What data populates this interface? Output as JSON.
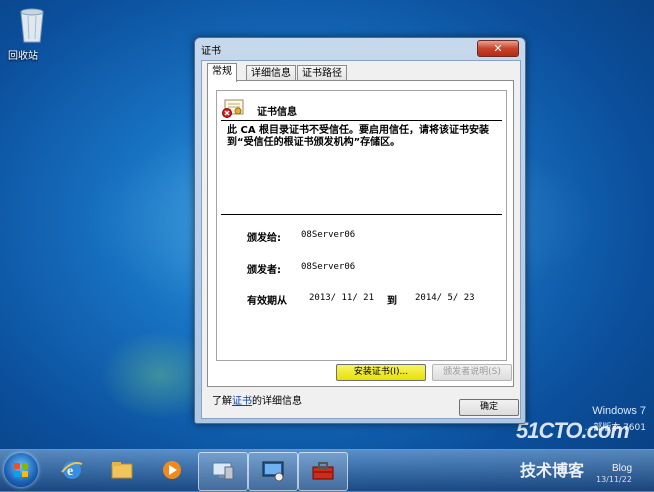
{
  "desktop": {
    "recycle_bin_label": "回收站",
    "os_name": "Windows 7",
    "build_text": "...部版本 7601",
    "watermark_site": "51CTO.com",
    "watermark_sub": "技术博客",
    "watermark_blog": "Blog",
    "watermark_date": "13/11/22"
  },
  "dialog": {
    "title": "证书",
    "close_label": "✕",
    "tabs": [
      {
        "label": "常规"
      },
      {
        "label": "详细信息"
      },
      {
        "label": "证书路径"
      }
    ],
    "cert_info_title": "证书信息",
    "message": "此 CA 根目录证书不受信任。要启用信任，请将该证书安装到“受信任的根证书颁发机构”存储区。",
    "issued_to_label": "颁发给:",
    "issued_to_value": "08Server06",
    "issued_by_label": "颁发者:",
    "issued_by_value": "08Server06",
    "valid_from_label": "有效期从",
    "valid_from_value": "2013/ 11/ 21",
    "valid_to_label": "到",
    "valid_to_value": "2014/ 5/ 23",
    "install_button": "安装证书(I)...",
    "issuer_statement_button": "颁发者说明(S)",
    "learn_prefix": "了解",
    "learn_link": "证书",
    "learn_suffix": "的详细信息",
    "ok_button": "确定"
  },
  "colors": {
    "install_highlight": "#e8e200",
    "link": "#0645ad",
    "close_button": "#c8432b"
  },
  "taskbar": {
    "items": [
      {
        "icon": "start-orb-icon"
      },
      {
        "icon": "internet-explorer-icon"
      },
      {
        "icon": "file-explorer-icon"
      },
      {
        "icon": "media-player-icon"
      },
      {
        "icon": "server-manager-icon"
      },
      {
        "icon": "remote-desktop-icon"
      },
      {
        "icon": "toolbox-icon"
      }
    ]
  }
}
